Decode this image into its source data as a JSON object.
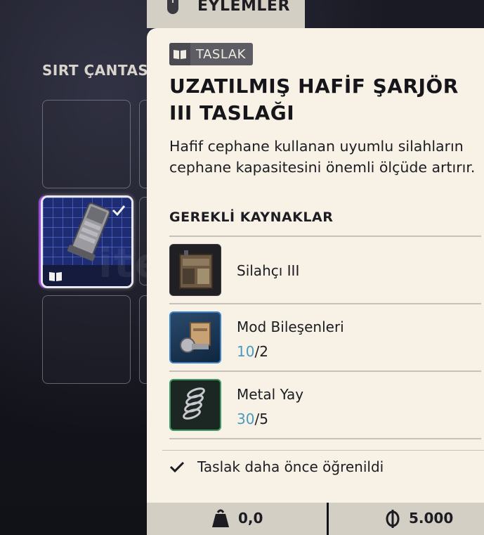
{
  "backpack": {
    "title": "SIRT ÇANTASI"
  },
  "actions_tab": {
    "label": "EYLEMLER"
  },
  "item": {
    "tag": "TASLAK",
    "name": "UZATILMIŞ HAFİF ŞARJÖR III TASLAĞI",
    "description": "Hafif cephane kullanan uyumlu silahların cephane kapasitesini önemli ölçüde artırır."
  },
  "requirements": {
    "title": "GEREKLİ KAYNAKLAR",
    "items": [
      {
        "name": "Silahçı III",
        "icon": "workbench-icon"
      },
      {
        "name": "Mod Bileşenleri",
        "have": "10",
        "need": "/2",
        "icon": "mod-components-icon"
      },
      {
        "name": "Metal Yay",
        "have": "30",
        "need": "/5",
        "icon": "metal-spring-icon"
      }
    ]
  },
  "status": {
    "learned": "Taslak daha önce öğrenildi"
  },
  "footer": {
    "weight": "0,0",
    "price": "5.000"
  },
  "colors": {
    "panel_bg": "#f8f2e6",
    "tab_bg": "#d4cfc4",
    "count_have": "#4a9ac0",
    "mod_border": "#3b82c4",
    "spring_border": "#3f9a63"
  }
}
